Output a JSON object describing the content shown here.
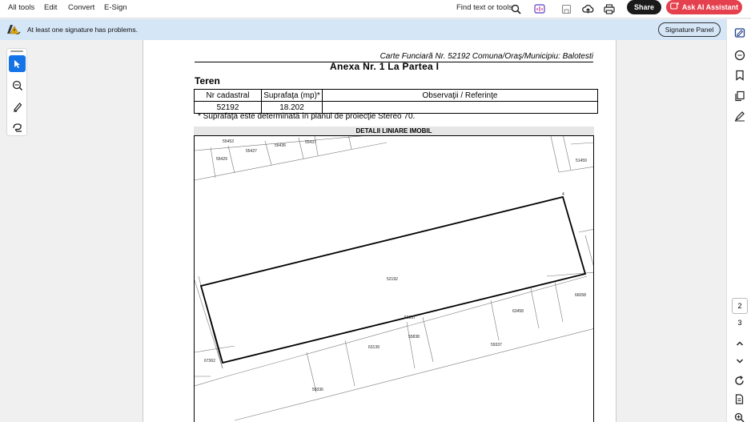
{
  "menu": {
    "all_tools": "All tools",
    "edit": "Edit",
    "convert": "Convert",
    "esign": "E-Sign",
    "find": "Find text or tools",
    "share": "Share",
    "ask_ai": "Ask AI Assistant"
  },
  "banner": {
    "message": "At least one signature has problems.",
    "signature_panel": "Signature Panel"
  },
  "pagination": {
    "current": "2",
    "next": "3"
  },
  "document": {
    "header_line": "Carte Funciară Nr. 52192 Comuna/Oraş/Municipiu: Balotesti",
    "anexa_title": "Anexa Nr. 1 La Partea I",
    "section_title": "Teren",
    "table": {
      "headers": [
        "Nr cadastral",
        "Suprafaţa (mp)*",
        "Observaţii / Referinţe"
      ],
      "row": [
        "52192",
        "18.202",
        ""
      ]
    },
    "note": "* Suprafaţa este determinată în planul de proiecţie Stereo 70.",
    "detalii": "DETALII LINIARE IMOBIL",
    "plan_labels": {
      "main_parcel": "52192",
      "p1": "55453",
      "p2": "55427",
      "p3": "55436",
      "p4": "55437",
      "p5": "55429",
      "p6": "51459",
      "p7": "66058",
      "p8": "63458",
      "p9": "59337",
      "p10": "55837",
      "p11": "63139",
      "p12": "55838",
      "p13": "67362",
      "p14": "59336",
      "vertex": "4"
    }
  },
  "colors": {
    "accent": "#1473e6",
    "ai_button": "#e5404e",
    "banner_bg": "#d5e6f7"
  }
}
